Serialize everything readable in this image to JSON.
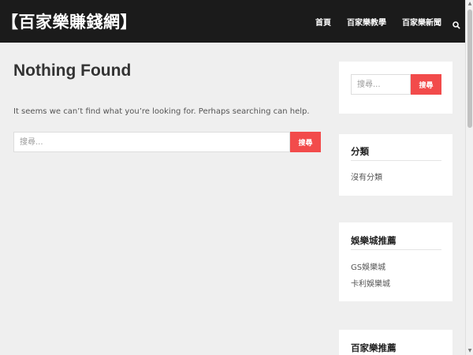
{
  "header": {
    "site_title": "【百家樂賺錢網】",
    "nav": [
      "首頁",
      "百家樂教學",
      "百家樂新聞"
    ],
    "search_icon": "search-icon"
  },
  "main": {
    "title": "Nothing Found",
    "text": "It seems we can’t find what you’re looking for. Perhaps searching can help.",
    "search_placeholder": "搜尋...",
    "search_button": "搜尋"
  },
  "sidebar": {
    "search_placeholder": "搜尋...",
    "search_button": "搜尋",
    "widgets": [
      {
        "title": "分類",
        "items": [
          "沒有分類"
        ]
      },
      {
        "title": "娛樂城推薦",
        "items": [
          "GS娛樂城",
          "卡利娛樂城"
        ]
      },
      {
        "title": "百家樂推薦",
        "items": []
      }
    ]
  },
  "colors": {
    "header_bg": "#1b1b1b",
    "accent": "#f24b4b",
    "page_bg": "#efefef"
  }
}
